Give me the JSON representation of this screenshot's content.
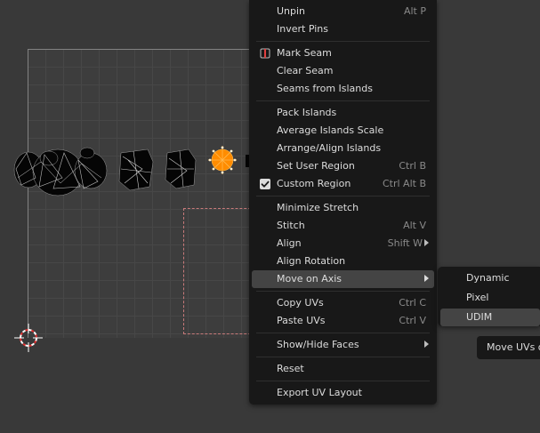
{
  "main_menu": {
    "items": [
      {
        "label": "Unpin",
        "shortcut": "Alt P"
      },
      {
        "label": "Invert Pins",
        "shortcut": ""
      },
      {
        "label": "Mark Seam",
        "shortcut": "",
        "icon": "mark-seam-icon"
      },
      {
        "label": "Clear Seam",
        "shortcut": ""
      },
      {
        "label": "Seams from Islands",
        "shortcut": ""
      },
      {
        "label": "Pack Islands",
        "shortcut": ""
      },
      {
        "label": "Average Islands Scale",
        "shortcut": ""
      },
      {
        "label": "Arrange/Align Islands",
        "shortcut": ""
      },
      {
        "label": "Set User Region",
        "shortcut": "Ctrl B"
      },
      {
        "label": "Custom Region",
        "shortcut": "Ctrl Alt B",
        "checked": true
      },
      {
        "label": "Minimize Stretch",
        "shortcut": ""
      },
      {
        "label": "Stitch",
        "shortcut": "Alt V"
      },
      {
        "label": "Align",
        "shortcut": "Shift W",
        "submenu": true
      },
      {
        "label": "Align Rotation",
        "shortcut": ""
      },
      {
        "label": "Move on Axis",
        "shortcut": "",
        "submenu": true,
        "highlighted": true
      },
      {
        "label": "Copy UVs",
        "shortcut": "Ctrl C"
      },
      {
        "label": "Paste UVs",
        "shortcut": "Ctrl V"
      },
      {
        "label": "Show/Hide Faces",
        "shortcut": "",
        "submenu": true
      },
      {
        "label": "Reset",
        "shortcut": ""
      },
      {
        "label": "Export UV Layout",
        "shortcut": ""
      }
    ]
  },
  "sub_menu": {
    "items": [
      {
        "label": "Dynamic"
      },
      {
        "label": "Pixel"
      },
      {
        "label": "UDIM",
        "highlighted": true
      }
    ]
  },
  "tooltip": {
    "text": "Move UVs o"
  },
  "colors": {
    "background": "#393939",
    "menu_bg": "#181818",
    "highlight": "#444444",
    "text": "#dcdcdc",
    "shortcut": "#8a8a8a",
    "selected_vertex": "#ff8c00",
    "region_border": "#c87a7a"
  }
}
